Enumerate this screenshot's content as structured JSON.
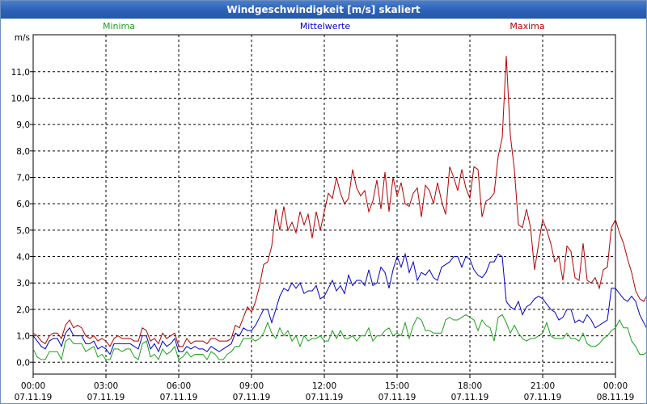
{
  "window": {
    "title": "Windgeschwindigkeit [m/s] skaliert"
  },
  "colors": {
    "minima": "#1aa01a",
    "mittelwerte": "#0000c8",
    "maxima": "#b40000",
    "grid": "#000000",
    "titlebar": "#2d62b8"
  },
  "chart_data": {
    "type": "line",
    "title": "Windgeschwindigkeit [m/s] skaliert",
    "ylabel": "m/s",
    "ylim": [
      -0.45,
      12.4
    ],
    "yticks": [
      "0,0",
      "1,0",
      "2,0",
      "3,0",
      "4,0",
      "5,0",
      "6,0",
      "7,0",
      "8,0",
      "9,0",
      "10,0",
      "11,0"
    ],
    "xlim": [
      0,
      24
    ],
    "xticks": [
      {
        "time": "00:00",
        "date": "07.11.19"
      },
      {
        "time": "03:00",
        "date": "07.11.19"
      },
      {
        "time": "06:00",
        "date": "07.11.19"
      },
      {
        "time": "09:00",
        "date": "07.11.19"
      },
      {
        "time": "12:00",
        "date": "07.11.19"
      },
      {
        "time": "15:00",
        "date": "07.11.19"
      },
      {
        "time": "18:00",
        "date": "07.11.19"
      },
      {
        "time": "21:00",
        "date": "07.11.19"
      },
      {
        "time": "00:00",
        "date": "08.11.19"
      }
    ],
    "grid": true,
    "legend_position": "top",
    "step_minutes": 10,
    "series": [
      {
        "name": "Minima",
        "values": [
          0.5,
          0.2,
          0.1,
          0.1,
          0.4,
          0.4,
          0.4,
          0.1,
          0.8,
          0.9,
          0.7,
          0.7,
          0.7,
          0.4,
          0.5,
          0.6,
          0.2,
          0.3,
          0.1,
          0.1,
          0.5,
          0.5,
          0.4,
          0.5,
          0.5,
          0.2,
          0.1,
          0.7,
          0.8,
          0.2,
          0.3,
          0.1,
          0.5,
          0.3,
          0.4,
          0.6,
          0.1,
          0.2,
          0.4,
          0.2,
          0.3,
          0.3,
          0.3,
          0.1,
          0.4,
          0.3,
          0.1,
          0.1,
          0.3,
          0.4,
          0.6,
          0.6,
          0.9,
          0.9,
          0.9,
          0.8,
          0.9,
          1.1,
          1.5,
          1.1,
          0.9,
          1.3,
          1.0,
          1.2,
          0.8,
          1.0,
          0.6,
          1.0,
          0.8,
          0.9,
          0.9,
          1.0,
          0.8,
          0.8,
          1.2,
          0.9,
          1.2,
          0.9,
          0.9,
          1.0,
          0.8,
          1.0,
          1.0,
          1.3,
          0.8,
          1.0,
          1.0,
          1.2,
          1.3,
          1.0,
          1.1,
          1.0,
          1.5,
          0.9,
          1.4,
          1.7,
          1.6,
          1.2,
          1.2,
          1.1,
          1.1,
          1.1,
          1.6,
          1.7,
          1.6,
          1.6,
          1.7,
          1.8,
          1.7,
          1.6,
          1.2,
          1.6,
          1.4,
          1.3,
          0.8,
          1.7,
          1.8,
          1.5,
          1.1,
          1.4,
          1.1,
          0.9,
          0.8,
          0.9,
          0.9,
          1.0,
          1.1,
          1.5,
          1.0,
          0.9,
          0.9,
          0.9,
          1.1,
          0.9,
          0.9,
          0.8,
          1.1,
          0.7,
          0.6,
          0.6,
          0.7,
          0.9,
          1.0,
          1.2,
          1.3,
          1.6,
          1.3,
          1.3,
          0.8,
          0.6,
          0.3,
          0.3,
          0.4
        ]
      },
      {
        "name": "Mittelwerte",
        "values": [
          1.0,
          0.8,
          0.6,
          0.5,
          0.8,
          0.9,
          0.9,
          0.6,
          1.1,
          1.3,
          1.0,
          1.0,
          1.0,
          0.7,
          0.7,
          0.8,
          0.5,
          0.6,
          0.5,
          0.3,
          0.7,
          0.7,
          0.7,
          0.7,
          0.7,
          0.6,
          0.5,
          1.0,
          1.0,
          0.5,
          0.7,
          0.4,
          0.8,
          0.6,
          0.7,
          0.9,
          0.4,
          0.4,
          0.6,
          0.5,
          0.6,
          0.5,
          0.5,
          0.4,
          0.6,
          0.5,
          0.4,
          0.5,
          0.6,
          0.7,
          1.1,
          1.0,
          1.3,
          1.2,
          1.2,
          1.4,
          1.7,
          2.0,
          2.0,
          1.5,
          2.0,
          2.5,
          2.8,
          2.7,
          3.0,
          2.8,
          3.0,
          2.6,
          2.7,
          2.7,
          2.9,
          2.4,
          2.5,
          2.8,
          3.1,
          2.7,
          2.9,
          2.6,
          3.3,
          2.9,
          3.1,
          3.1,
          2.9,
          3.5,
          2.9,
          3.0,
          3.6,
          3.4,
          2.8,
          3.5,
          4.0,
          3.6,
          4.1,
          3.4,
          3.8,
          3.1,
          3.4,
          3.3,
          3.5,
          3.2,
          3.1,
          3.6,
          3.7,
          3.8,
          4.0,
          4.0,
          3.6,
          4.0,
          3.9,
          3.5,
          3.3,
          3.2,
          3.4,
          3.8,
          3.8,
          4.1,
          4.0,
          2.3,
          2.1,
          2.0,
          2.3,
          1.8,
          2.1,
          2.2,
          2.4,
          2.5,
          2.4,
          2.2,
          2.0,
          1.9,
          1.6,
          1.7,
          2.0,
          2.0,
          1.5,
          1.6,
          1.5,
          1.8,
          1.6,
          1.3,
          1.4,
          1.5,
          1.6,
          2.8,
          2.8,
          2.6,
          2.4,
          2.3,
          2.5,
          2.3,
          1.8,
          1.5,
          1.2,
          1.1,
          1.0
        ]
      },
      {
        "name": "Maxima",
        "values": [
          1.1,
          1.0,
          0.8,
          0.7,
          1.0,
          1.1,
          1.1,
          0.9,
          1.4,
          1.6,
          1.3,
          1.4,
          1.3,
          1.0,
          0.9,
          1.0,
          0.8,
          0.9,
          0.8,
          0.6,
          0.9,
          1.0,
          0.9,
          0.9,
          0.9,
          0.8,
          0.8,
          1.3,
          1.2,
          0.8,
          0.9,
          0.7,
          1.1,
          0.9,
          1.0,
          1.1,
          0.6,
          0.6,
          0.9,
          0.7,
          0.8,
          0.8,
          0.8,
          0.7,
          0.9,
          0.9,
          0.8,
          0.8,
          0.8,
          0.9,
          1.4,
          1.3,
          1.7,
          2.1,
          1.9,
          2.3,
          2.9,
          3.7,
          3.8,
          4.4,
          5.8,
          5.0,
          5.9,
          5.0,
          5.3,
          4.9,
          5.7,
          5.2,
          5.6,
          4.7,
          5.7,
          5.0,
          5.7,
          6.4,
          6.2,
          7.0,
          6.4,
          6.0,
          6.2,
          7.3,
          6.6,
          6.3,
          6.5,
          5.7,
          6.1,
          6.9,
          5.8,
          7.2,
          5.7,
          7.0,
          6.3,
          6.8,
          6.0,
          5.9,
          6.4,
          6.6,
          5.5,
          6.7,
          6.5,
          6.0,
          6.8,
          6.1,
          5.6,
          7.4,
          7.0,
          6.5,
          7.3,
          6.6,
          6.2,
          7.4,
          7.3,
          5.5,
          6.1,
          6.2,
          6.4,
          7.8,
          8.5,
          11.6,
          8.6,
          7.3,
          5.2,
          5.1,
          5.8,
          5.1,
          3.5,
          4.5,
          5.4,
          5.0,
          4.5,
          3.8,
          4.0,
          3.1,
          4.4,
          4.2,
          3.2,
          3.1,
          4.5,
          3.1,
          3.0,
          3.2,
          2.8,
          3.5,
          3.6,
          5.1,
          5.4,
          4.9,
          4.5,
          3.9,
          3.4,
          2.7,
          2.4,
          2.3,
          2.6
        ]
      }
    ]
  }
}
